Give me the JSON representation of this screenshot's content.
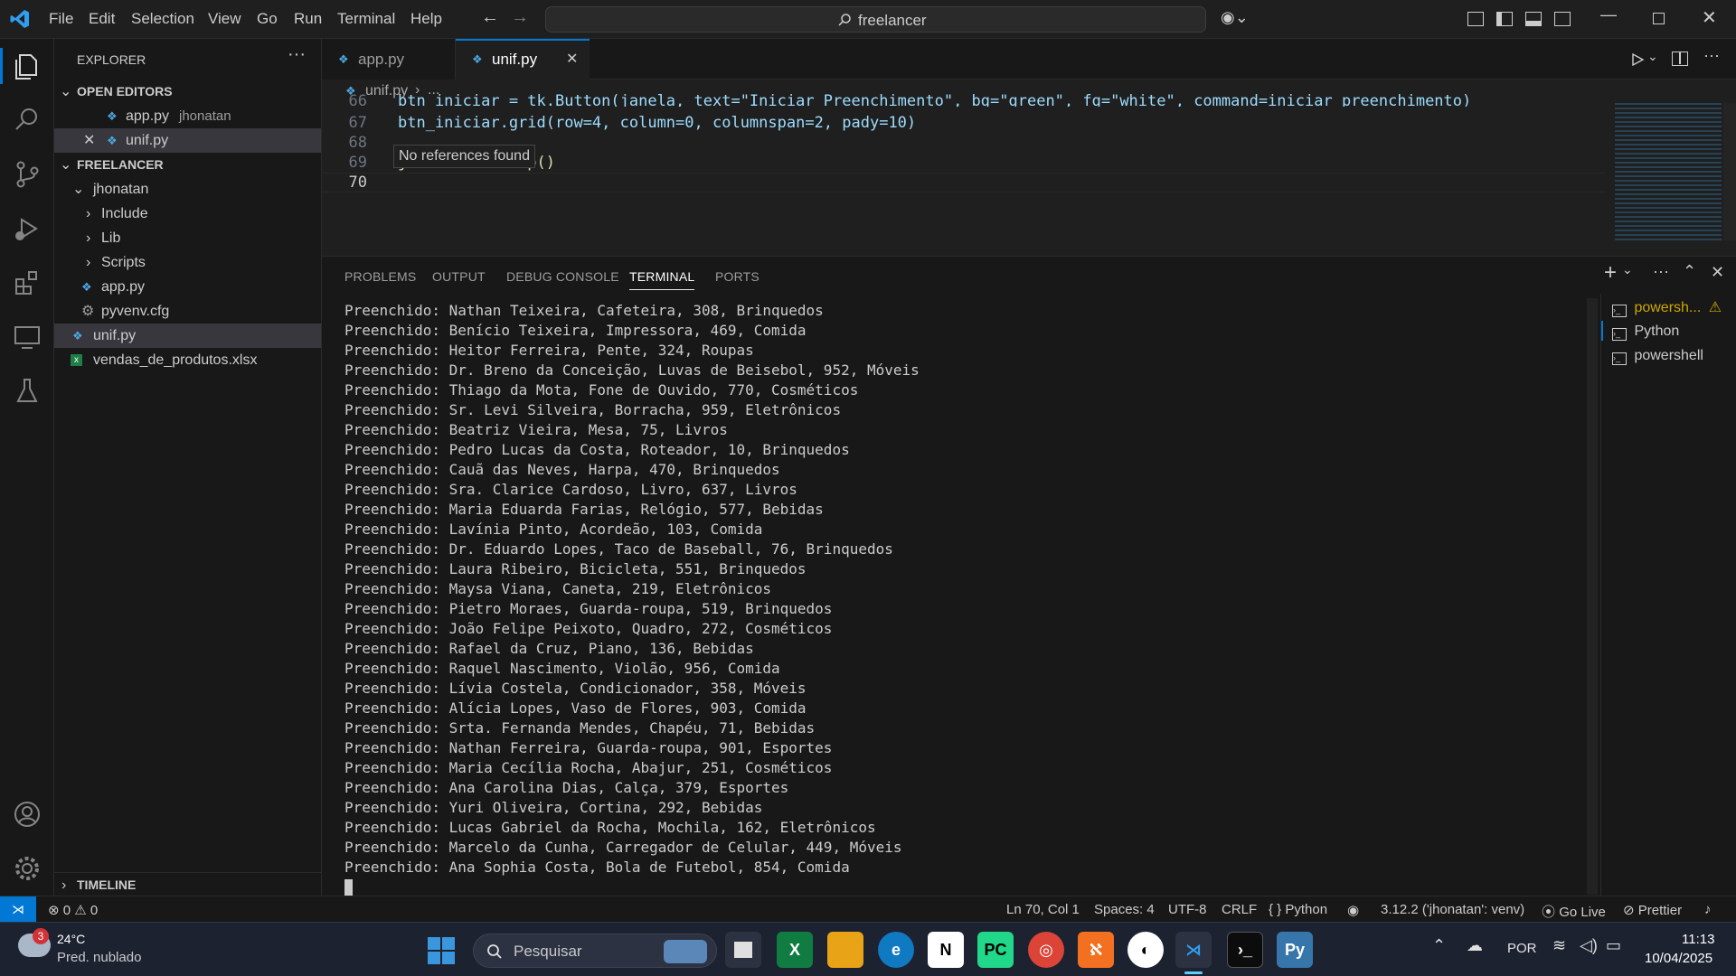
{
  "menu": [
    "File",
    "Edit",
    "Selection",
    "View",
    "Go",
    "Run",
    "Terminal",
    "Help"
  ],
  "command_center": "freelancer",
  "sidebar": {
    "title": "EXPLORER",
    "open_editors_header": "OPEN EDITORS",
    "open_editors": [
      {
        "name": "app.py",
        "suffix": "jhonatan"
      },
      {
        "name": "unif.py"
      }
    ],
    "folder_header": "FREELANCER",
    "tree": [
      "jhonatan",
      "Include",
      "Lib",
      "Scripts",
      "app.py",
      "pyvenv.cfg",
      "unif.py",
      "vendas_de_produtos.xlsx"
    ],
    "timeline": "TIMELINE"
  },
  "tabs": [
    {
      "label": "app.py"
    },
    {
      "label": "unif.py"
    }
  ],
  "breadcrumb": {
    "file": "unif.py",
    "rest": "..."
  },
  "editor": {
    "lines": [
      {
        "n": "66",
        "text": "btn_iniciar = tk.Button(janela, text=\"Iniciar Preenchimento\", bg=\"green\", fg=\"white\", command=iniciar_preenchimento)"
      },
      {
        "n": "67",
        "text": "btn_iniciar.grid(row=4, column=0, columnspan=2, pady=10)"
      },
      {
        "n": "68",
        "text": ""
      },
      {
        "n": "69",
        "text": "janela.mainloop()"
      },
      {
        "n": "70",
        "text": ""
      }
    ],
    "tooltip": "No references found"
  },
  "panel": {
    "tabs": [
      "PROBLEMS",
      "OUTPUT",
      "DEBUG CONSOLE",
      "TERMINAL",
      "PORTS"
    ],
    "terminal_lines": [
      "Preenchido: Nathan Teixeira, Cafeteira, 308, Brinquedos",
      "Preenchido: Benício Teixeira, Impressora, 469, Comida",
      "Preenchido: Heitor Ferreira, Pente, 324, Roupas",
      "Preenchido: Dr. Breno da Conceição, Luvas de Beisebol, 952, Móveis",
      "Preenchido: Thiago da Mota, Fone de Ouvido, 770, Cosméticos",
      "Preenchido: Sr. Levi Silveira, Borracha, 959, Eletrônicos",
      "Preenchido: Beatriz Vieira, Mesa, 75, Livros",
      "Preenchido: Pedro Lucas da Costa, Roteador, 10, Brinquedos",
      "Preenchido: Cauã das Neves, Harpa, 470, Brinquedos",
      "Preenchido: Sra. Clarice Cardoso, Livro, 637, Livros",
      "Preenchido: Maria Eduarda Farias, Relógio, 577, Bebidas",
      "Preenchido: Lavínia Pinto, Acordeão, 103, Comida",
      "Preenchido: Dr. Eduardo Lopes, Taco de Baseball, 76, Brinquedos",
      "Preenchido: Laura Ribeiro, Bicicleta, 551, Brinquedos",
      "Preenchido: Maysa Viana, Caneta, 219, Eletrônicos",
      "Preenchido: Pietro Moraes, Guarda-roupa, 519, Brinquedos",
      "Preenchido: João Felipe Peixoto, Quadro, 272, Cosméticos",
      "Preenchido: Rafael da Cruz, Piano, 136, Bebidas",
      "Preenchido: Raquel Nascimento, Violão, 956, Comida",
      "Preenchido: Lívia Costela, Condicionador, 358, Móveis",
      "Preenchido: Alícia Lopes, Vaso de Flores, 903, Comida",
      "Preenchido: Srta. Fernanda Mendes, Chapéu, 71, Bebidas",
      "Preenchido: Nathan Ferreira, Guarda-roupa, 901, Esportes",
      "Preenchido: Maria Cecília Rocha, Abajur, 251, Cosméticos",
      "Preenchido: Ana Carolina Dias, Calça, 379, Esportes",
      "Preenchido: Yuri Oliveira, Cortina, 292, Bebidas",
      "Preenchido: Lucas Gabriel da Rocha, Mochila, 162, Eletrônicos",
      "Preenchido: Marcelo da Cunha, Carregador de Celular, 449, Móveis",
      "Preenchido: Ana Sophia Costa, Bola de Futebol, 854, Comida"
    ],
    "terminals": [
      "powersh...",
      "Python",
      "powershell"
    ]
  },
  "statusbar": {
    "errors": "0",
    "warnings": "0",
    "position": "Ln 70, Col 1",
    "spaces": "Spaces: 4",
    "encoding": "UTF-8",
    "eol": "CRLF",
    "language": "Python",
    "interpreter": "3.12.2 ('jhonatan': venv)",
    "golive": "Go Live",
    "prettier": "Prettier"
  },
  "taskbar": {
    "weather_temp": "24°C",
    "weather_desc": "Pred. nublado",
    "weather_badge": "3",
    "search": "Pesquisar",
    "lang": "POR",
    "time": "11:13",
    "date": "10/04/2025"
  },
  "colors": {
    "accent": "#0078d4",
    "python_icon": "#4ea5e0",
    "warning": "#cca700"
  }
}
